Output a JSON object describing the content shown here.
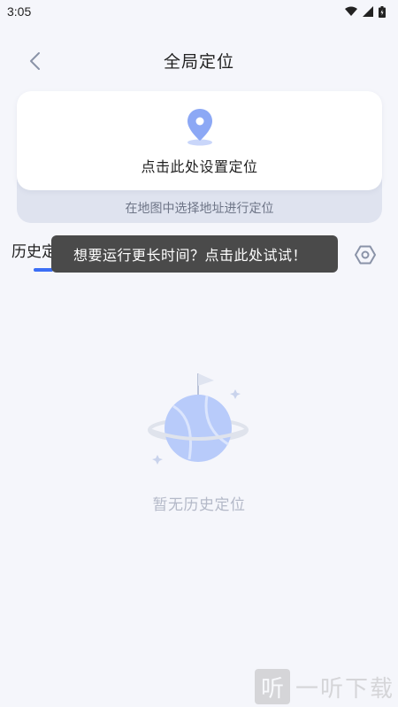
{
  "status_bar": {
    "time": "3:05"
  },
  "header": {
    "title": "全局定位"
  },
  "locate_card": {
    "label": "点击此处设置定位",
    "map_hint": "在地图中选择地址进行定位"
  },
  "tabs": {
    "history_label": "历史定位"
  },
  "tooltip": {
    "text": "想要运行更长时间？点击此处试试！"
  },
  "empty_state": {
    "text": "暂无历史定位"
  },
  "watermark": {
    "glyph": "听",
    "text": "一听下载"
  },
  "colors": {
    "accent": "#3b6ef5",
    "pin": "#8ca8f5",
    "background": "#f5f6fb",
    "tooltip_bg": "#4a4a4a"
  }
}
